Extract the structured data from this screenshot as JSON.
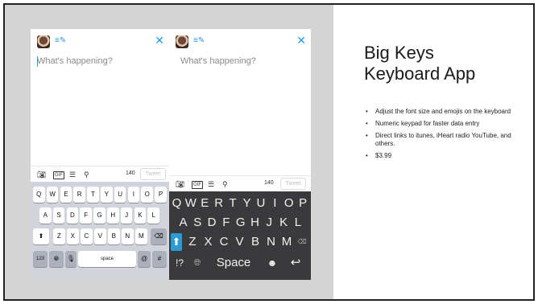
{
  "slide": {
    "title_line1": "Big Keys",
    "title_line2": "Keyboard App",
    "bullets": [
      "Adjust the font size and emojis on the keyboard",
      "Numeric keypad for faster data entry",
      "Direct links to itunes, iHeart radio YouTube, and others.",
      "$3.99"
    ],
    "bullet_glyph": "•"
  },
  "phones": {
    "left": {
      "placeholder": "What's happening?",
      "count": "140",
      "tweet_label": "Tweet",
      "gif_label": "GIF",
      "keys_row1": [
        "Q",
        "W",
        "E",
        "R",
        "T",
        "Y",
        "U",
        "I",
        "O",
        "P"
      ],
      "keys_row2": [
        "A",
        "S",
        "D",
        "F",
        "G",
        "H",
        "J",
        "K",
        "L"
      ],
      "keys_row3": [
        "Z",
        "X",
        "C",
        "V",
        "B",
        "N",
        "M"
      ],
      "key_123": "123",
      "key_space": "space",
      "key_at": "@",
      "key_hash": "#"
    },
    "right": {
      "placeholder": "What's happening?",
      "count": "140",
      "tweet_label": "Tweet",
      "gif_label": "GIF",
      "keys_row1": [
        "Q",
        "W",
        "E",
        "R",
        "T",
        "Y",
        "U",
        "I",
        "O",
        "P"
      ],
      "keys_row2": [
        "A",
        "S",
        "D",
        "F",
        "G",
        "H",
        "J",
        "K",
        "L"
      ],
      "keys_row3": [
        "Z",
        "X",
        "C",
        "V",
        "B",
        "N",
        "M"
      ],
      "key_sym": "!?",
      "key_space": "Space"
    }
  },
  "icons": {
    "close": "close-icon",
    "camera": "camera-icon",
    "gif": "gif-icon",
    "poll": "poll-icon",
    "location": "location-pin-icon",
    "shift": "shift-arrow-icon",
    "backspace": "backspace-icon",
    "globe": "globe-icon",
    "mic": "microphone-icon",
    "emoji": "emoji-icon",
    "return": "return-icon"
  },
  "colors": {
    "accent": "#1d9bf0",
    "bigkey_shift": "#2b9bd3",
    "bigkey_bg": "#3a3a3c",
    "panel_bg": "#d4d4d4"
  }
}
